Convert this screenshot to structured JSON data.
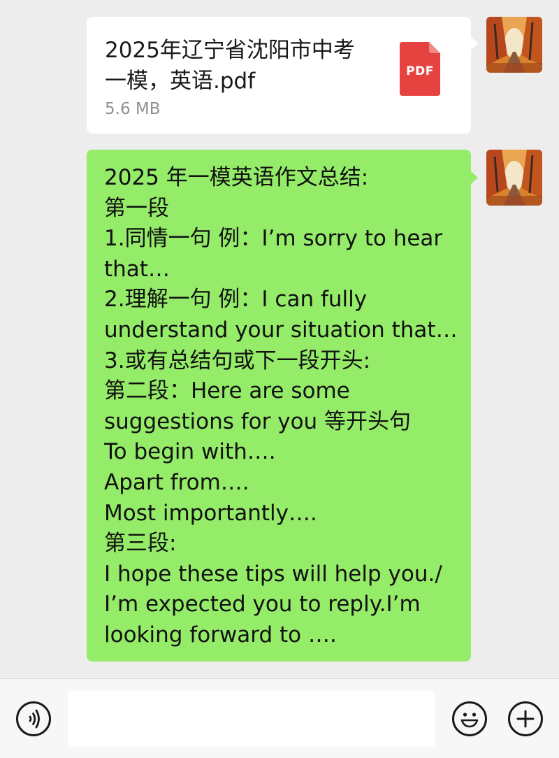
{
  "messages": [
    {
      "type": "file",
      "sender": "self",
      "file_name": "2025年辽宁省沈阳市中考一模，英语.pdf",
      "file_name_lines": [
        "2025年辽宁省沈阳市中考",
        "一模，英语.pdf"
      ],
      "file_size": "5.6 MB",
      "file_type_label": "PDF"
    },
    {
      "type": "text",
      "sender": "self",
      "lines": [
        " 2025 年一模英语作文总结:",
        "第一段",
        "1.同情一句 例：I’m sorry to hear",
        "that…",
        "2.理解一句 例：I can fully",
        "understand your situation that…",
        "3.或有总结句或下一段开头:",
        "第二段：Here are some",
        "suggestions for you 等开头句",
        "To begin with….",
        "Apart from….",
        "Most importantly….",
        "第三段:",
        "I hope these tips will help you./",
        "I’m expected you to reply.I’m",
        "looking forward to …."
      ]
    }
  ],
  "input_bar": {
    "value": "",
    "voice_icon": "voice-icon",
    "emoji_icon": "emoji-icon",
    "more_icon": "plus-icon"
  },
  "colors": {
    "background": "#ededed",
    "self_bubble": "#95ec69",
    "file_bubble": "#ffffff",
    "pdf_icon": "#e64340"
  }
}
